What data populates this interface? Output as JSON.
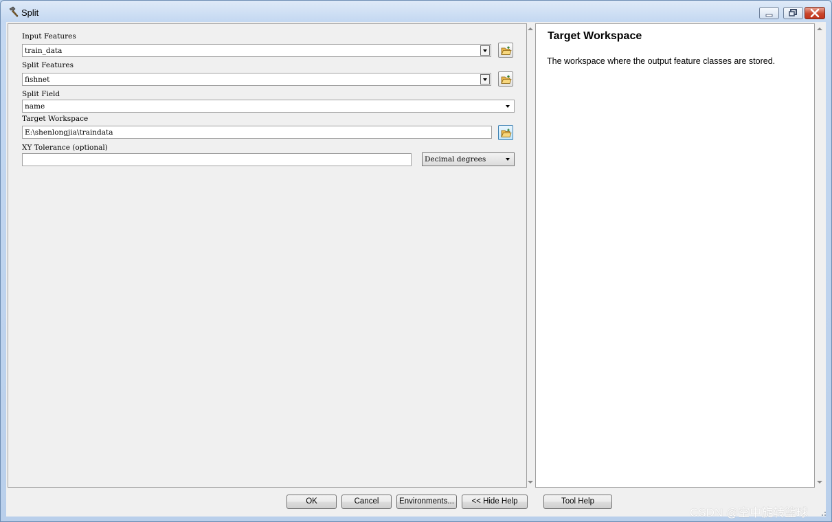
{
  "window": {
    "title": "Split"
  },
  "form": {
    "input_features": {
      "label": "Input Features",
      "value": "train_data"
    },
    "split_features": {
      "label": "Split Features",
      "value": "fishnet"
    },
    "split_field": {
      "label": "Split Field",
      "value": "name"
    },
    "target_workspace": {
      "label": "Target Workspace",
      "value": "E:\\shenlongjia\\traindata"
    },
    "xy_tolerance": {
      "label": "XY Tolerance (optional)",
      "value": "",
      "unit": "Decimal degrees"
    }
  },
  "help": {
    "title": "Target Workspace",
    "body": "The workspace where the output feature classes are stored."
  },
  "buttons": {
    "ok": "OK",
    "cancel": "Cancel",
    "environments": "Environments...",
    "hide_help": "<< Hide Help",
    "tool_help": "Tool Help"
  },
  "watermark": "CSDN @空中旋转篮球",
  "icons": [
    "hammer-icon",
    "minimize-icon",
    "maximize-icon",
    "close-icon",
    "folder-open-icon"
  ]
}
